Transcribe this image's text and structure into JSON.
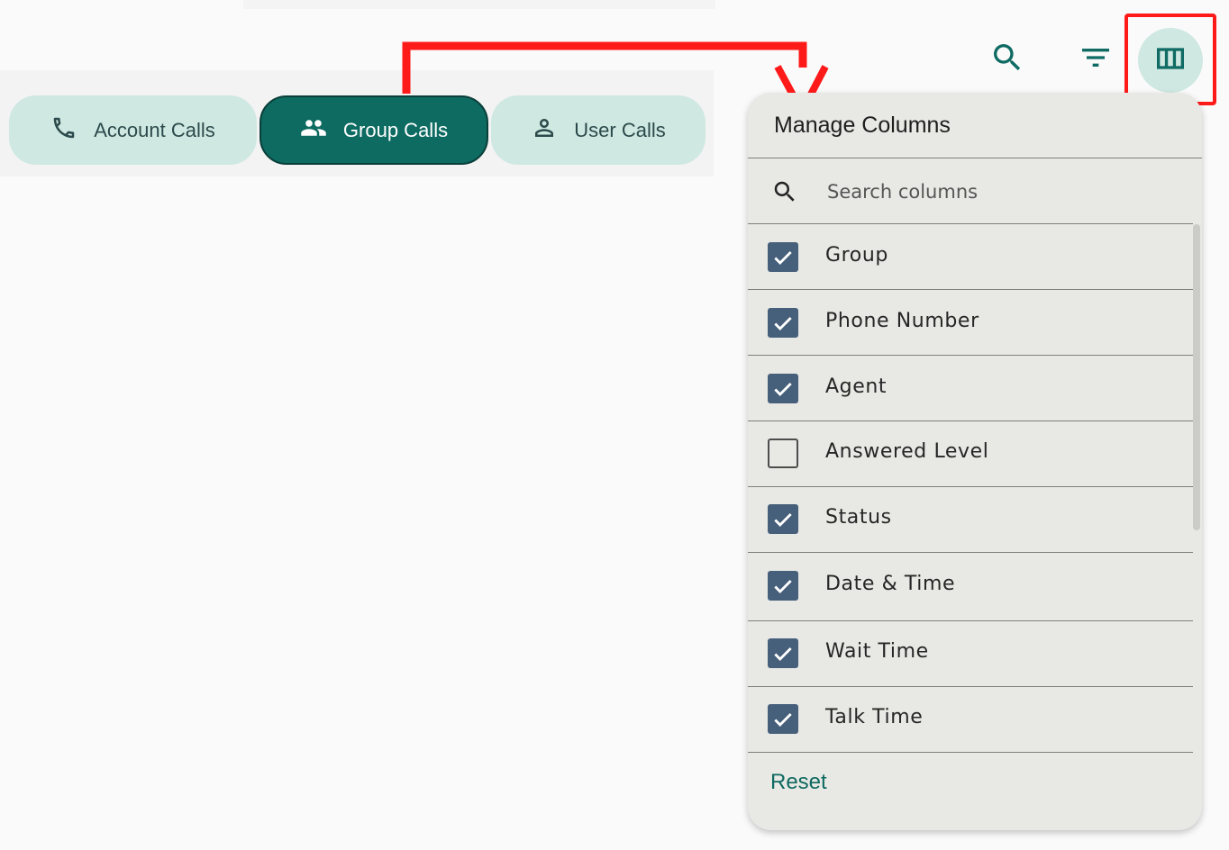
{
  "tabs": [
    {
      "label": "Account Calls",
      "icon": "phone-icon"
    },
    {
      "label": "Group Calls",
      "icon": "group-icon",
      "selected": true
    },
    {
      "label": "User Calls",
      "icon": "person-icon"
    }
  ],
  "toolbar": {
    "search_icon": "search-icon",
    "filter_icon": "filter-icon",
    "columns_icon": "view-columns-icon"
  },
  "colors": {
    "accent": "#0d6b61",
    "chip": "#cfe8e2",
    "checkbox": "#465f7a",
    "annotation": "#ff1a1a"
  },
  "manage_columns": {
    "title": "Manage Columns",
    "search_placeholder": "Search columns",
    "columns": [
      {
        "label": "Group",
        "checked": true
      },
      {
        "label": "Phone Number",
        "checked": true
      },
      {
        "label": "Agent",
        "checked": true
      },
      {
        "label": "Answered Level",
        "checked": false
      },
      {
        "label": "Status",
        "checked": true
      },
      {
        "label": "Date & Time",
        "checked": true
      },
      {
        "label": "Wait Time",
        "checked": true
      },
      {
        "label": "Talk Time",
        "checked": true
      }
    ],
    "reset_label": "Reset"
  }
}
